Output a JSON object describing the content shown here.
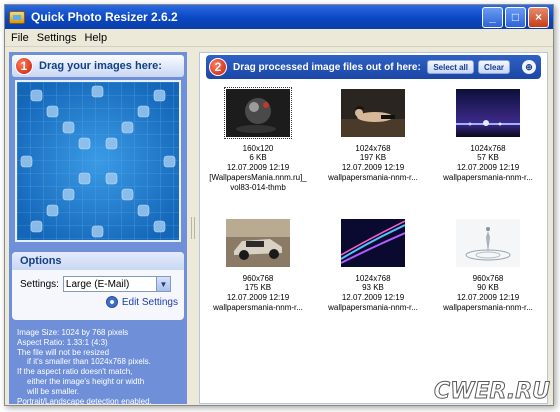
{
  "window": {
    "title": "Quick Photo Resizer 2.6.2",
    "controls": {
      "minimize": "_",
      "maximize": "□",
      "close": "×"
    }
  },
  "menu": [
    "File",
    "Settings",
    "Help"
  ],
  "left_panel": {
    "step": "1",
    "title": "Drag your images here:",
    "options": {
      "title": "Options",
      "settings_label": "Settings:",
      "settings_value": "Large (E-Mail)",
      "edit_settings": "Edit Settings"
    },
    "info_lines": [
      "Image Size: 1024 by 768 pixels",
      "Aspect Ratio: 1.33:1 (4:3)",
      "The file will not be resized",
      "if it's smaller than 1024x768 pixels.",
      "If the aspect ratio doesn't match,",
      "either the image's height or width",
      "will be smaller.",
      "Portrait/Landscape detection enabled."
    ]
  },
  "right_panel": {
    "step": "2",
    "title": "Drag processed image files out of here:",
    "select_all": "Select all",
    "clear": "Clear",
    "pin_icon": "pin-icon",
    "thumbnails": [
      {
        "dims": "160x120",
        "size": "6 KB",
        "date": "12.07.2009 12:19",
        "name": "[WallpapersMania.nnm.ru]_vol83-014-thmb",
        "selected": true,
        "image": "dark-sphere-photo"
      },
      {
        "dims": "1024x768",
        "size": "197 KB",
        "date": "12.07.2009 12:19",
        "name": "wallpapersmania-nnm-r...",
        "selected": false,
        "image": "woman-reclining-photo"
      },
      {
        "dims": "1024x768",
        "size": "57 KB",
        "date": "12.07.2009 12:19",
        "name": "wallpapersmania-nnm-r...",
        "selected": false,
        "image": "night-city-lights-photo"
      },
      {
        "dims": "960x768",
        "size": "175 KB",
        "date": "12.07.2009 12:19",
        "name": "wallpapersmania-nnm-r...",
        "selected": false,
        "image": "offroad-car-photo"
      },
      {
        "dims": "1024x768",
        "size": "93 KB",
        "date": "12.07.2009 12:19",
        "name": "wallpapersmania-nnm-r...",
        "selected": false,
        "image": "neon-light-streaks-photo"
      },
      {
        "dims": "960x768",
        "size": "90 KB",
        "date": "12.07.2009 12:19",
        "name": "wallpapersmania-nnm-r...",
        "selected": false,
        "image": "water-splash-photo"
      }
    ]
  },
  "watermark": "CWER.RU",
  "colors": {
    "titlebar": "#0a47c2",
    "panel_blue": "#6f8fd8",
    "dropzone": "#1d7fd0",
    "step_badge": "#c8200a"
  }
}
